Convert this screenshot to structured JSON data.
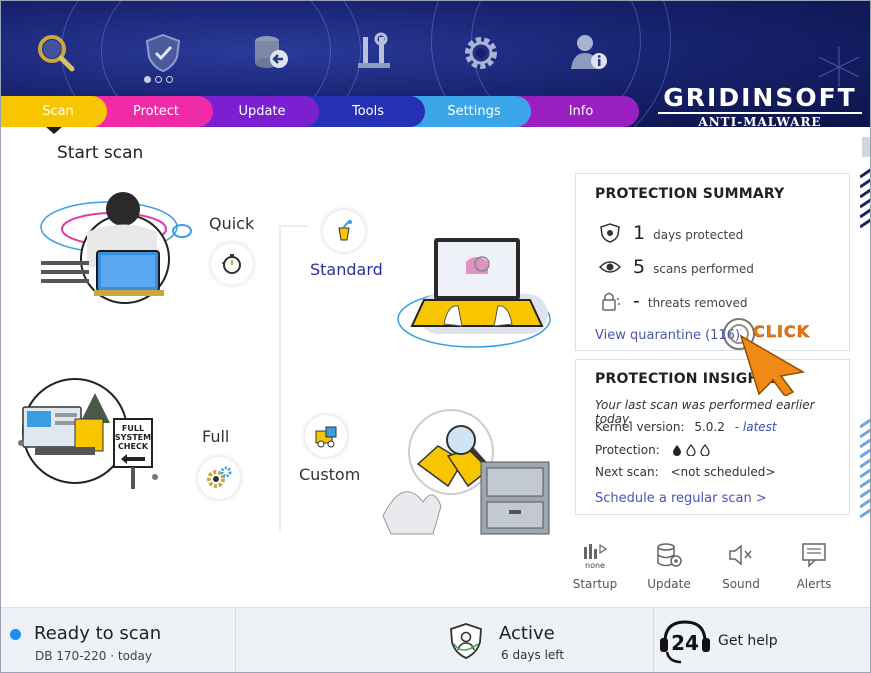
{
  "header": {
    "tabs": [
      {
        "id": "scan",
        "label": "Scan"
      },
      {
        "id": "protect",
        "label": "Protect"
      },
      {
        "id": "update",
        "label": "Update"
      },
      {
        "id": "tools",
        "label": "Tools"
      },
      {
        "id": "settings",
        "label": "Settings"
      },
      {
        "id": "info",
        "label": "Info"
      }
    ],
    "toolbar_icons": [
      "search-icon",
      "shield-icon",
      "database-update-icon",
      "tools-icon",
      "gear-icon",
      "user-info-icon"
    ],
    "logo": {
      "main": "GRIDINSOFT",
      "sub": "ANTI-MALWARE"
    }
  },
  "main": {
    "title": "Start scan",
    "scan_types": {
      "quick": "Quick",
      "standard": "Standard",
      "full": "Full",
      "custom": "Custom"
    },
    "full_system_sign": [
      "FULL",
      "SYSTEM",
      "CHECK"
    ]
  },
  "summary": {
    "title": "PROTECTION SUMMARY",
    "days_value": "1",
    "days_label": "days protected",
    "scans_value": "5",
    "scans_label": "scans performed",
    "threats_value": "-",
    "threats_label": "threats removed",
    "view_quarantine": "View quarantine (116)"
  },
  "insights": {
    "title": "PROTECTION INSIGHTS",
    "last_scan": "Your last scan was performed earlier today.",
    "kernel_label": "Kernel version:",
    "kernel_value": "5.0.2",
    "kernel_sep": "-",
    "kernel_latest": "latest",
    "protection_label": "Protection:",
    "next_scan_label": "Next scan:",
    "next_scan_value": "<not scheduled>",
    "schedule_link": "Schedule a regular scan >"
  },
  "annotation": {
    "click": "CLICK"
  },
  "mini_buttons": [
    {
      "id": "startup",
      "label": "Startup",
      "badge": "none"
    },
    {
      "id": "update",
      "label": "Update"
    },
    {
      "id": "sound",
      "label": "Sound"
    },
    {
      "id": "alerts",
      "label": "Alerts"
    }
  ],
  "footer": {
    "ready_title": "Ready to scan",
    "ready_sub": "DB 170-220 · today",
    "active_title": "Active",
    "active_sub": "6 days left",
    "help_badge": "24",
    "help_text": "Get help"
  },
  "colors": {
    "header_bg": "#15206a",
    "tab_scan": "#f7c600",
    "tab_protect": "#ee2aa6",
    "tab_update": "#7a20d0",
    "tab_tools": "#2531b4",
    "tab_settings": "#3aa6e8",
    "tab_info": "#9a1fc0",
    "link": "#4a55b0",
    "click_orange": "#e8760c",
    "ready_dot": "#1f8ef1"
  }
}
